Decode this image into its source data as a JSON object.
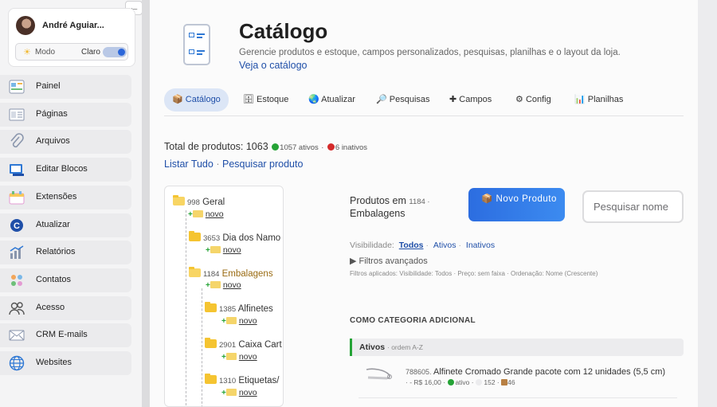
{
  "user": {
    "name": "André Aguiar...",
    "mode_label": "Modo",
    "mode_value": "Claro"
  },
  "collapse_icon": "arrow-left-icon",
  "nav": [
    {
      "label": "Painel",
      "icon": "dashboard-icon"
    },
    {
      "label": "Páginas",
      "icon": "pages-icon"
    },
    {
      "label": "Arquivos",
      "icon": "paperclip-icon"
    },
    {
      "label": "Editar Blocos",
      "icon": "blocks-icon"
    },
    {
      "label": "Extensões",
      "icon": "extensions-icon"
    },
    {
      "label": "Atualizar",
      "icon": "update-icon"
    },
    {
      "label": "Relatórios",
      "icon": "reports-icon"
    },
    {
      "label": "Contatos",
      "icon": "contacts-icon"
    },
    {
      "label": "Acesso",
      "icon": "access-icon"
    },
    {
      "label": "CRM E-mails",
      "icon": "mail-icon"
    },
    {
      "label": "Websites",
      "icon": "globe-icon"
    }
  ],
  "header": {
    "title": "Catálogo",
    "description": "Gerencie produtos e estoque, campos personalizados, pesquisas, planilhas e o layout da loja.",
    "link": "Veja o catálogo"
  },
  "tabs": [
    {
      "icon": "📦",
      "label": "Catálogo",
      "active": true
    },
    {
      "icon": "🗄",
      "label": "Estoque"
    },
    {
      "icon": "🌏",
      "label": "Atualizar"
    },
    {
      "icon": "🔎",
      "label": "Pesquisas"
    },
    {
      "icon": "✚",
      "label": "Campos"
    },
    {
      "icon": "⚙",
      "label": "Config"
    },
    {
      "icon": "📊",
      "label": "Planilhas"
    }
  ],
  "summary": {
    "total_label": "Total de produtos:",
    "total": "1063",
    "active": "1057 ativos",
    "separator": "·",
    "inactive": "6 inativos",
    "list_all": "Listar Tudo",
    "search_product": "Pesquisar produto"
  },
  "tree": {
    "new_label": "novo",
    "nodes": [
      {
        "id": "998",
        "name": "Geral"
      },
      {
        "id": "3653",
        "name": "Dia dos Namo"
      },
      {
        "id": "1184",
        "name": "Embalagens",
        "active": true
      },
      {
        "id": "1385",
        "name": "Alfinetes"
      },
      {
        "id": "2901",
        "name": "Caixa Cart"
      },
      {
        "id": "1310",
        "name": "Etiquetas/"
      }
    ]
  },
  "products": {
    "heading_prefix": "Produtos em",
    "category_id": "1184",
    "category_name": "Embalagens",
    "new_button_icon": "📦",
    "new_button": "Novo Produto",
    "search_placeholder": "Pesquisar nome",
    "visibility_label": "Visibilidade:",
    "visibility_options": [
      "Todos",
      "Ativos",
      "Inativos"
    ],
    "visibility_selected": "Todos",
    "advanced_filters": "▶ Filtros avançados",
    "applied_filters": "Filtros aplicados: Visibilidade: Todos · Preço: sem faixa · Ordenação: Nome (Crescente)",
    "section_title": "COMO CATEGORIA ADICIONAL",
    "group_label": "Ativos",
    "group_order": "· ordem A-Z",
    "items": [
      {
        "id": "788605.",
        "title": "Alfinete Cromado Grande pacote com 12 unidades (5,5 cm)",
        "price": "· - R$ 16,00 ·",
        "status": "ativo",
        "views": "152",
        "stock": "46"
      }
    ]
  }
}
